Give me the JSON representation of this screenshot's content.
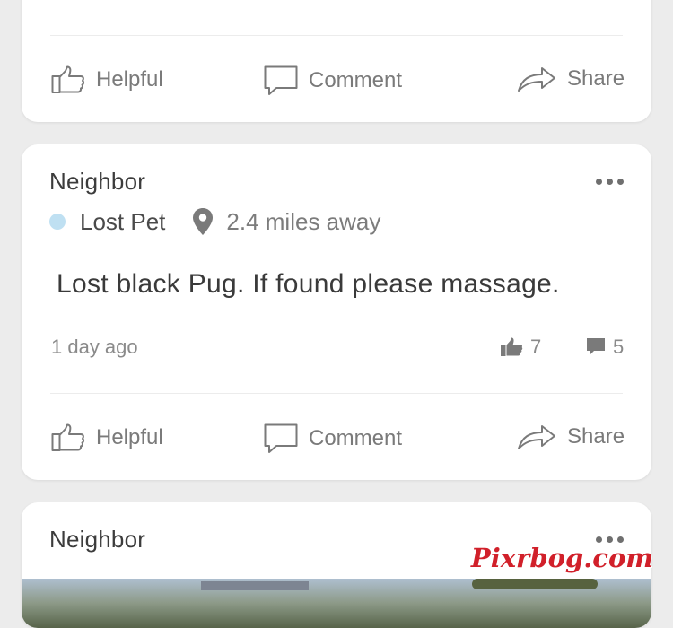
{
  "colors": {
    "background": "#ececec",
    "card": "#ffffff",
    "category_dot": "#bfe0f2",
    "watermark": "#d1202a"
  },
  "actions": {
    "helpful_label": "Helpful",
    "comment_label": "Comment",
    "share_label": "Share"
  },
  "post": {
    "author": "Neighbor",
    "category": "Lost Pet",
    "distance": "2.4 miles away",
    "text": "Lost black Pug. If found please massage.",
    "timestamp": "1 day ago",
    "helpful_count": "7",
    "comment_count": "5"
  },
  "next_post": {
    "author": "Neighbor"
  },
  "watermark": "Pixrbog.com",
  "icons": [
    "thumbs-up-outline-icon",
    "comment-outline-icon",
    "share-arrow-icon",
    "more-dots-icon",
    "location-pin-icon",
    "thumbs-up-filled-icon",
    "comment-filled-icon"
  ]
}
